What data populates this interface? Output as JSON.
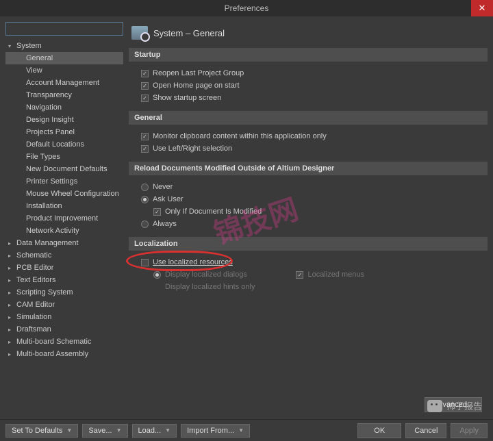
{
  "window": {
    "title": "Preferences"
  },
  "search": {
    "placeholder": ""
  },
  "tree": {
    "system": {
      "label": "System",
      "expanded": true,
      "children": [
        "General",
        "View",
        "Account Management",
        "Transparency",
        "Navigation",
        "Design Insight",
        "Projects Panel",
        "Default Locations",
        "File Types",
        "New Document Defaults",
        "Printer Settings",
        "Mouse Wheel Configuration",
        "Installation",
        "Product Improvement",
        "Network Activity"
      ]
    },
    "roots": [
      "Data Management",
      "Schematic",
      "PCB Editor",
      "Text Editors",
      "Scripting System",
      "CAM Editor",
      "Simulation",
      "Draftsman",
      "Multi-board Schematic",
      "Multi-board Assembly"
    ]
  },
  "page": {
    "title": "System – General",
    "startup": {
      "header": "Startup",
      "reopen": "Reopen Last Project Group",
      "openhome": "Open Home page on start",
      "showstartup": "Show startup screen"
    },
    "general": {
      "header": "General",
      "clipboard": "Monitor clipboard content within this application only",
      "leftright": "Use Left/Right selection"
    },
    "reload": {
      "header": "Reload Documents Modified Outside of Altium Designer",
      "never": "Never",
      "askuser": "Ask User",
      "onlyif": "Only If Document Is Modified",
      "always": "Always"
    },
    "localization": {
      "header": "Localization",
      "useLocalized": "Use localized resources",
      "displayDialogs": "Display localized dialogs",
      "localizedMenus": "Localized menus",
      "displayHints": "Display localized hints only"
    }
  },
  "buttons": {
    "advanced": "Advanced...",
    "defaults": "Set To Defaults",
    "save": "Save...",
    "load": "Load...",
    "import": "Import From...",
    "ok": "OK",
    "cancel": "Cancel",
    "apply": "Apply"
  },
  "overlay": {
    "watermark": "锦技网",
    "wechat": "帅子报告"
  }
}
